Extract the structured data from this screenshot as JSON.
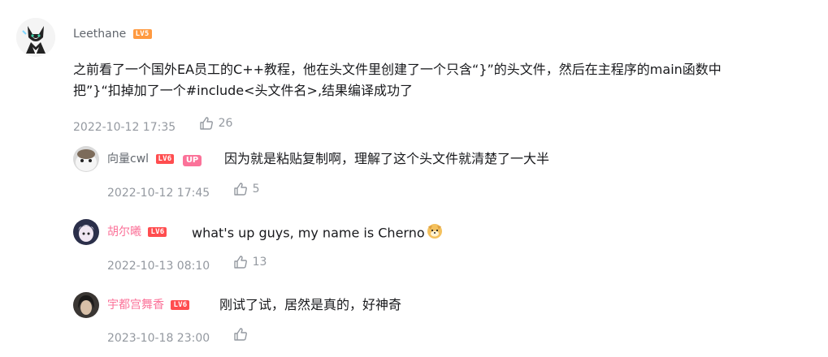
{
  "main_comment": {
    "user": "Leethane",
    "level": "LV5",
    "text_line1": "之前看了一个国外EA员工的C++教程，他在头文件里创建了一个只含“}”的头文件，然后在主程序的main函数中",
    "text_line2": "把”}“扣掉加了一个#include<头文件名>,结果编译成功了",
    "time": "2022-10-12 17:35",
    "likes": "26"
  },
  "replies": [
    {
      "user": "向量cwl",
      "level": "LV6",
      "badge": "UP",
      "text": "因为就是粘贴复制啊，理解了这个头文件就清楚了一大半",
      "time": "2022-10-12 17:45",
      "likes": "5"
    },
    {
      "user": "胡尔曦",
      "level": "LV6",
      "text": "what's up guys, my name is Cherno",
      "time": "2022-10-13 08:10",
      "likes": "13"
    },
    {
      "user": "宇都宫舞香",
      "level": "LV6",
      "text": "刚试了试，居然是真的，好神奇",
      "time": "2023-10-18 23:00",
      "likes": ""
    }
  ],
  "icons": {
    "like": "thumb-up-icon",
    "emoji": "doge-emoji"
  },
  "colors": {
    "pink_name": "#fb7299",
    "lv5": "#ff9a40",
    "lv6": "#ff4d4f",
    "meta": "#9499a0"
  }
}
